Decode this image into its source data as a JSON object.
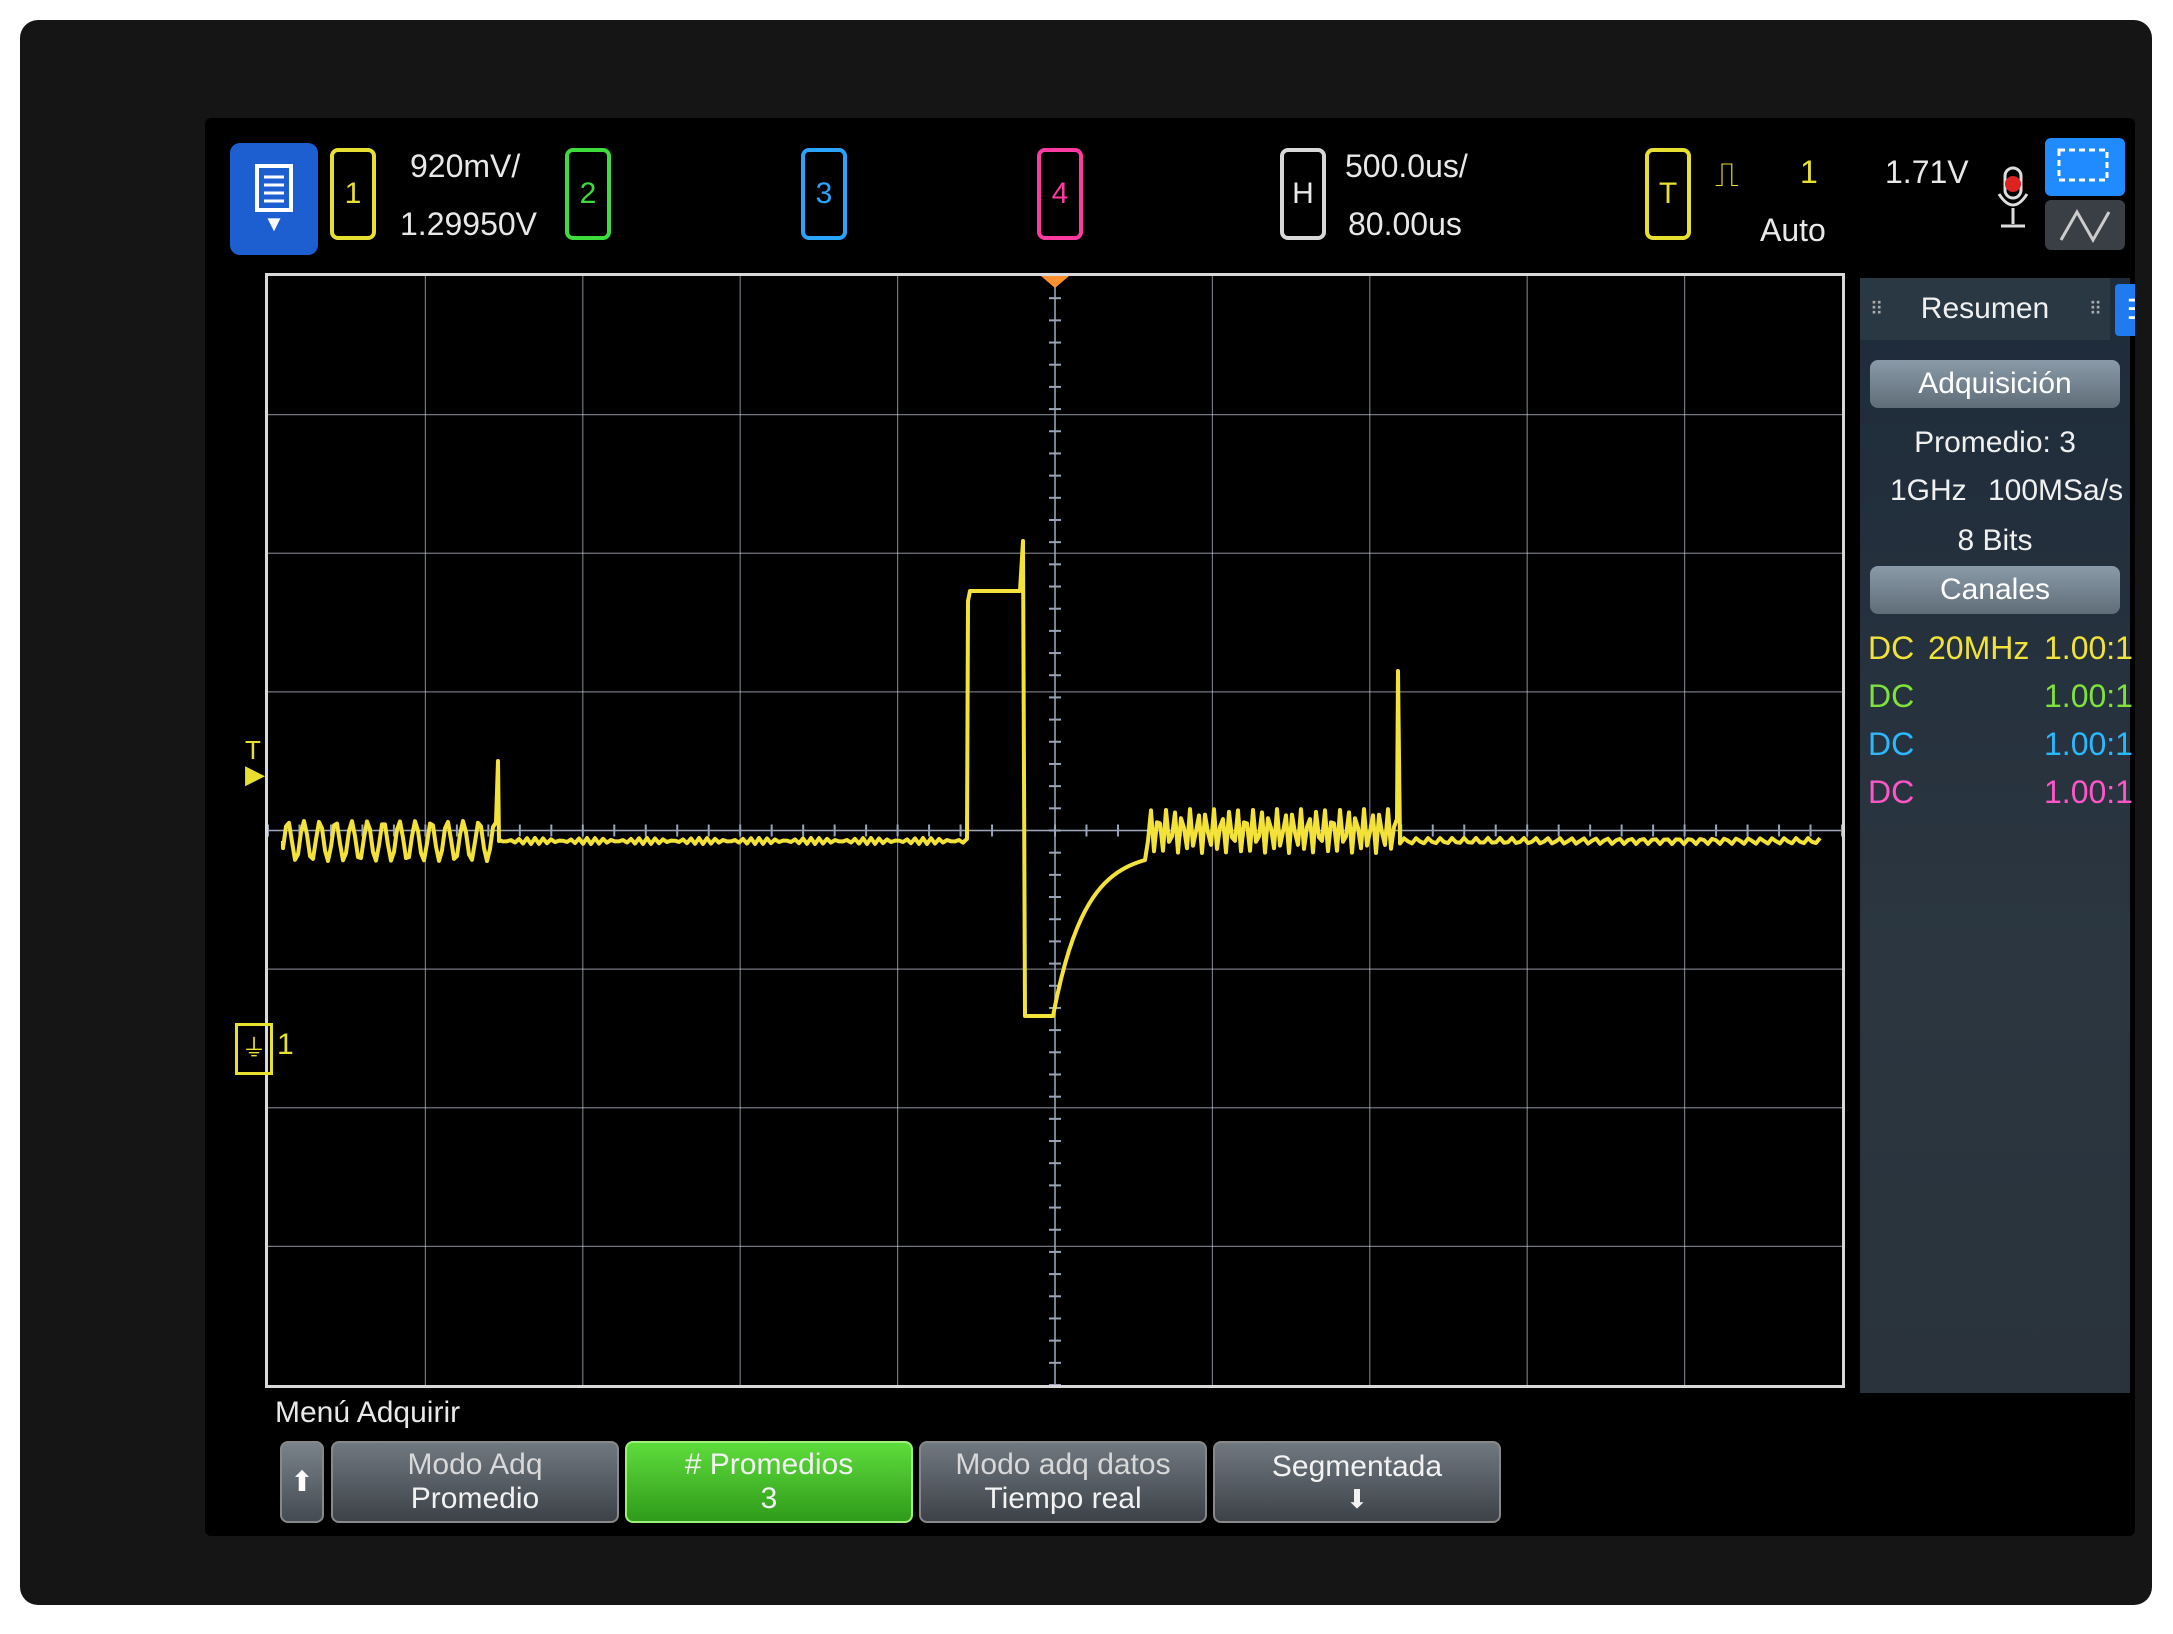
{
  "top_bar": {
    "channels": [
      {
        "id": "1",
        "color": "#e8e030",
        "scale": "920mV/",
        "offset": "1.29950V"
      },
      {
        "id": "2",
        "color": "#3ddc3d"
      },
      {
        "id": "3",
        "color": "#2aa4ff"
      },
      {
        "id": "4",
        "color": "#ff3aa0"
      }
    ],
    "horizontal": {
      "label": "H",
      "timebase": "500.0us/",
      "delay": "80.00us"
    },
    "trigger": {
      "label": "T",
      "source": "1",
      "level": "1.71V",
      "mode": "Auto"
    }
  },
  "side_panel": {
    "tab_title": "Resumen",
    "acq_header": "Adquisición",
    "average": "Promedio: 3",
    "bandwidth": "1GHz",
    "sample_rate": "100MSa/s",
    "bits": "8 Bits",
    "channels_header": "Canales",
    "channel_rows": [
      {
        "coupling": "DC",
        "bw": "20MHz",
        "probe": "1.00:1",
        "color": "#f2e23a"
      },
      {
        "coupling": "DC",
        "bw": "",
        "probe": "1.00:1",
        "color": "#7ee23a"
      },
      {
        "coupling": "DC",
        "bw": "",
        "probe": "1.00:1",
        "color": "#2ab8ff"
      },
      {
        "coupling": "DC",
        "bw": "",
        "probe": "1.00:1",
        "color": "#ff55c8"
      }
    ]
  },
  "markers": {
    "trigger_marker": "T",
    "ground_marker": "1"
  },
  "bottom_menu": {
    "title": "Menú Adquirir",
    "softkeys": [
      {
        "line1": "Modo Adq",
        "line2": "Promedio"
      },
      {
        "line1": "# Promedios",
        "line2": "3"
      },
      {
        "line1": "Modo adq datos",
        "line2": "Tiempo real"
      },
      {
        "line1": "Segmentada",
        "line2": ""
      }
    ]
  },
  "colors": {
    "trace": "#f2e23a",
    "grid": "#cfd6e6",
    "background": "#000000"
  }
}
